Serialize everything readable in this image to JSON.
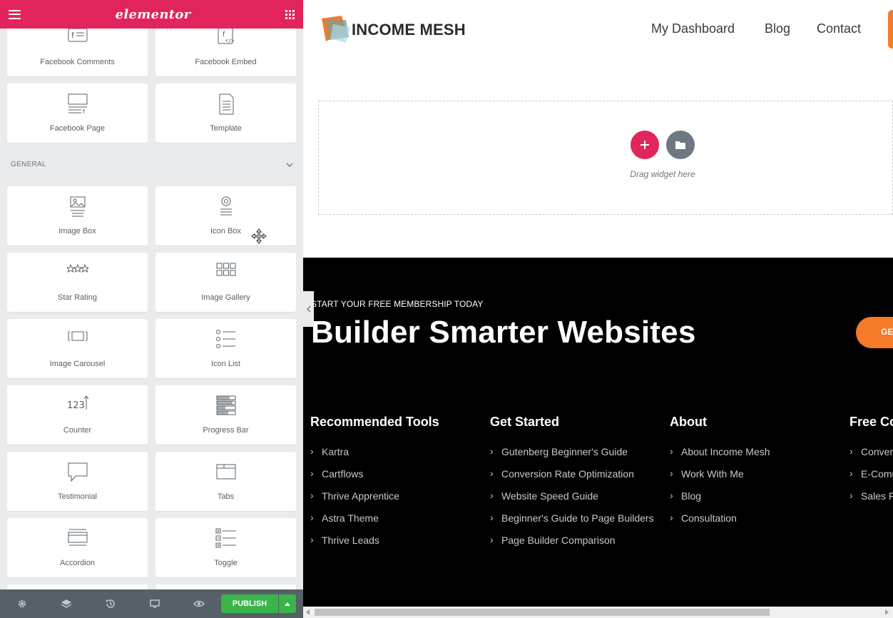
{
  "panel": {
    "brand": "elementor",
    "section_general": "GENERAL",
    "tiles": [
      {
        "label": "Facebook Comments"
      },
      {
        "label": "Facebook Embed"
      },
      {
        "label": "Facebook Page"
      },
      {
        "label": "Template"
      },
      {
        "label": "Image Box"
      },
      {
        "label": "Icon Box"
      },
      {
        "label": "Star Rating"
      },
      {
        "label": "Image Gallery"
      },
      {
        "label": "Image Carousel"
      },
      {
        "label": "Icon List"
      },
      {
        "label": "Counter"
      },
      {
        "label": "Progress Bar"
      },
      {
        "label": "Testimonial"
      },
      {
        "label": "Tabs"
      },
      {
        "label": "Accordion"
      },
      {
        "label": "Toggle"
      }
    ],
    "publish_label": "PUBLISH"
  },
  "site": {
    "logo": "INCOME MESH",
    "nav": [
      "My Dashboard",
      "Blog",
      "Contact"
    ],
    "drag_hint": "Drag widget here",
    "eyebrow": "START YOUR FREE MEMBERSHIP TODAY",
    "headline": "Builder Smarter Websites",
    "cta_partial": "GE",
    "columns": [
      {
        "title": "Recommended Tools",
        "links": [
          "Kartra",
          "Cartflows",
          "Thrive Apprentice",
          "Astra Theme",
          "Thrive Leads"
        ]
      },
      {
        "title": "Get Started",
        "links": [
          "Gutenberg Beginner's Guide",
          "Conversion Rate Optimization",
          "Website Speed Guide",
          "Beginner's Guide to Page Builders",
          "Page Builder Comparison"
        ]
      },
      {
        "title": "About",
        "links": [
          "About Income Mesh",
          "Work With Me",
          "Blog",
          "Consultation"
        ]
      },
      {
        "title": "Free Co",
        "links": [
          "Conver",
          "E-Comm",
          "Sales F"
        ]
      }
    ]
  },
  "colors": {
    "accent": "#e2245c",
    "cta": "#f57a2a",
    "publish": "#39b54a"
  }
}
